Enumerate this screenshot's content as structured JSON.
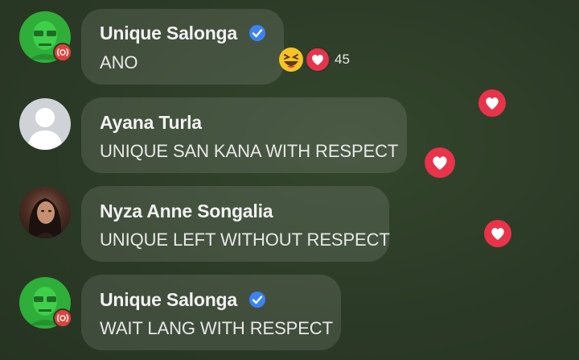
{
  "comments": [
    {
      "name": "Unique Salonga",
      "text": "ANO",
      "verified": true,
      "live": true,
      "reaction_count": "45"
    },
    {
      "name": "Ayana Turla",
      "text": "UNIQUE SAN KANA WITH RESPECT",
      "verified": false,
      "live": false
    },
    {
      "name": "Nyza Anne Songalia",
      "text": "UNIQUE LEFT WITHOUT RESPECT",
      "verified": false,
      "live": false
    },
    {
      "name": "Unique Salonga",
      "text": "WAIT LANG WITH RESPECT",
      "verified": true,
      "live": true
    }
  ],
  "icons": {
    "verified": "verified-badge-icon",
    "live": "live-badge-icon",
    "haha": "haha-reaction-icon",
    "love": "love-reaction-icon",
    "floating": "floating-heart-icon"
  },
  "colors": {
    "verified": "#3b82f6",
    "heart": "#e8334a",
    "live": "#e0413a"
  }
}
